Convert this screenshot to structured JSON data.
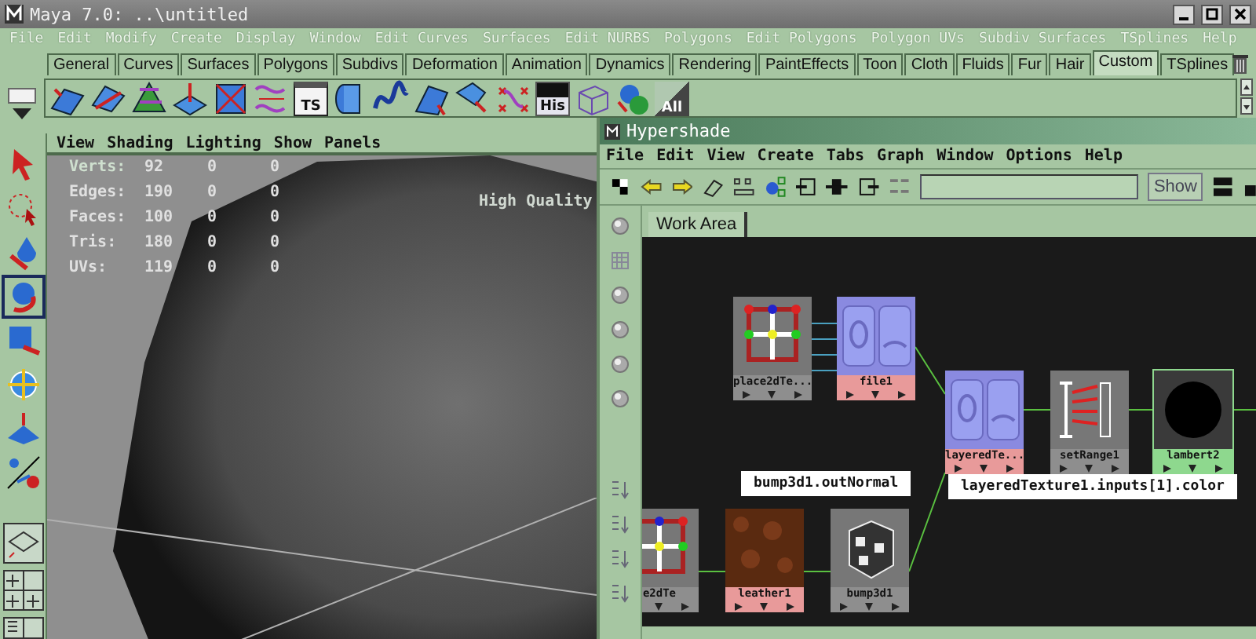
{
  "title_bar": {
    "title": "Maya 7.0: ..\\untitled"
  },
  "menu_bar": [
    "File",
    "Edit",
    "Modify",
    "Create",
    "Display",
    "Window",
    "Edit Curves",
    "Surfaces",
    "Edit NURBS",
    "Polygons",
    "Edit Polygons",
    "Polygon UVs",
    "Subdiv Surfaces",
    "TSplines",
    "Help"
  ],
  "shelf_tabs": [
    {
      "label": "General",
      "selected": false
    },
    {
      "label": "Curves",
      "selected": false
    },
    {
      "label": "Surfaces",
      "selected": false
    },
    {
      "label": "Polygons",
      "selected": false
    },
    {
      "label": "Subdivs",
      "selected": false
    },
    {
      "label": "Deformation",
      "selected": false
    },
    {
      "label": "Animation",
      "selected": false
    },
    {
      "label": "Dynamics",
      "selected": false
    },
    {
      "label": "Rendering",
      "selected": false
    },
    {
      "label": "PaintEffects",
      "selected": false
    },
    {
      "label": "Toon",
      "selected": false
    },
    {
      "label": "Cloth",
      "selected": false
    },
    {
      "label": "Fluids",
      "selected": false
    },
    {
      "label": "Fur",
      "selected": false
    },
    {
      "label": "Hair",
      "selected": false
    },
    {
      "label": "Custom",
      "selected": true
    },
    {
      "label": "TSplines",
      "selected": false
    }
  ],
  "shelf_labels": [
    "TS",
    "His",
    "All"
  ],
  "viewport": {
    "menu": [
      "View",
      "Shading",
      "Lighting",
      "Show",
      "Panels"
    ],
    "stats": [
      {
        "label": "Verts:",
        "values": [
          "92",
          "0",
          "0"
        ]
      },
      {
        "label": "Edges:",
        "values": [
          "190",
          "0",
          "0"
        ]
      },
      {
        "label": "Faces:",
        "values": [
          "100",
          "0",
          "0"
        ]
      },
      {
        "label": "Tris:",
        "values": [
          "180",
          "0",
          "0"
        ]
      },
      {
        "label": "UVs:",
        "values": [
          "119",
          "0",
          "0"
        ]
      }
    ],
    "quality": "High Quality"
  },
  "hypershade": {
    "title": "Hypershade",
    "menu": [
      "File",
      "Edit",
      "View",
      "Create",
      "Tabs",
      "Graph",
      "Window",
      "Options",
      "Help"
    ],
    "show_button": "Show",
    "tabs": [
      {
        "label": "Work Area",
        "selected": true
      }
    ],
    "nodes": [
      {
        "label": "place2dTe...",
        "kind": "utility"
      },
      {
        "label": "file1",
        "kind": "texture"
      },
      {
        "label": "layeredTe...",
        "kind": "texture"
      },
      {
        "label": "setRange1",
        "kind": "utility"
      },
      {
        "label": "lambert2",
        "kind": "shader"
      },
      {
        "label": "e2dTe",
        "kind": "utility"
      },
      {
        "label": "leather1",
        "kind": "texture"
      },
      {
        "label": "bump3d1",
        "kind": "utility"
      }
    ],
    "connection_labels": [
      "bump3d1.outNormal",
      "layeredTexture1.inputs[1].color"
    ]
  }
}
